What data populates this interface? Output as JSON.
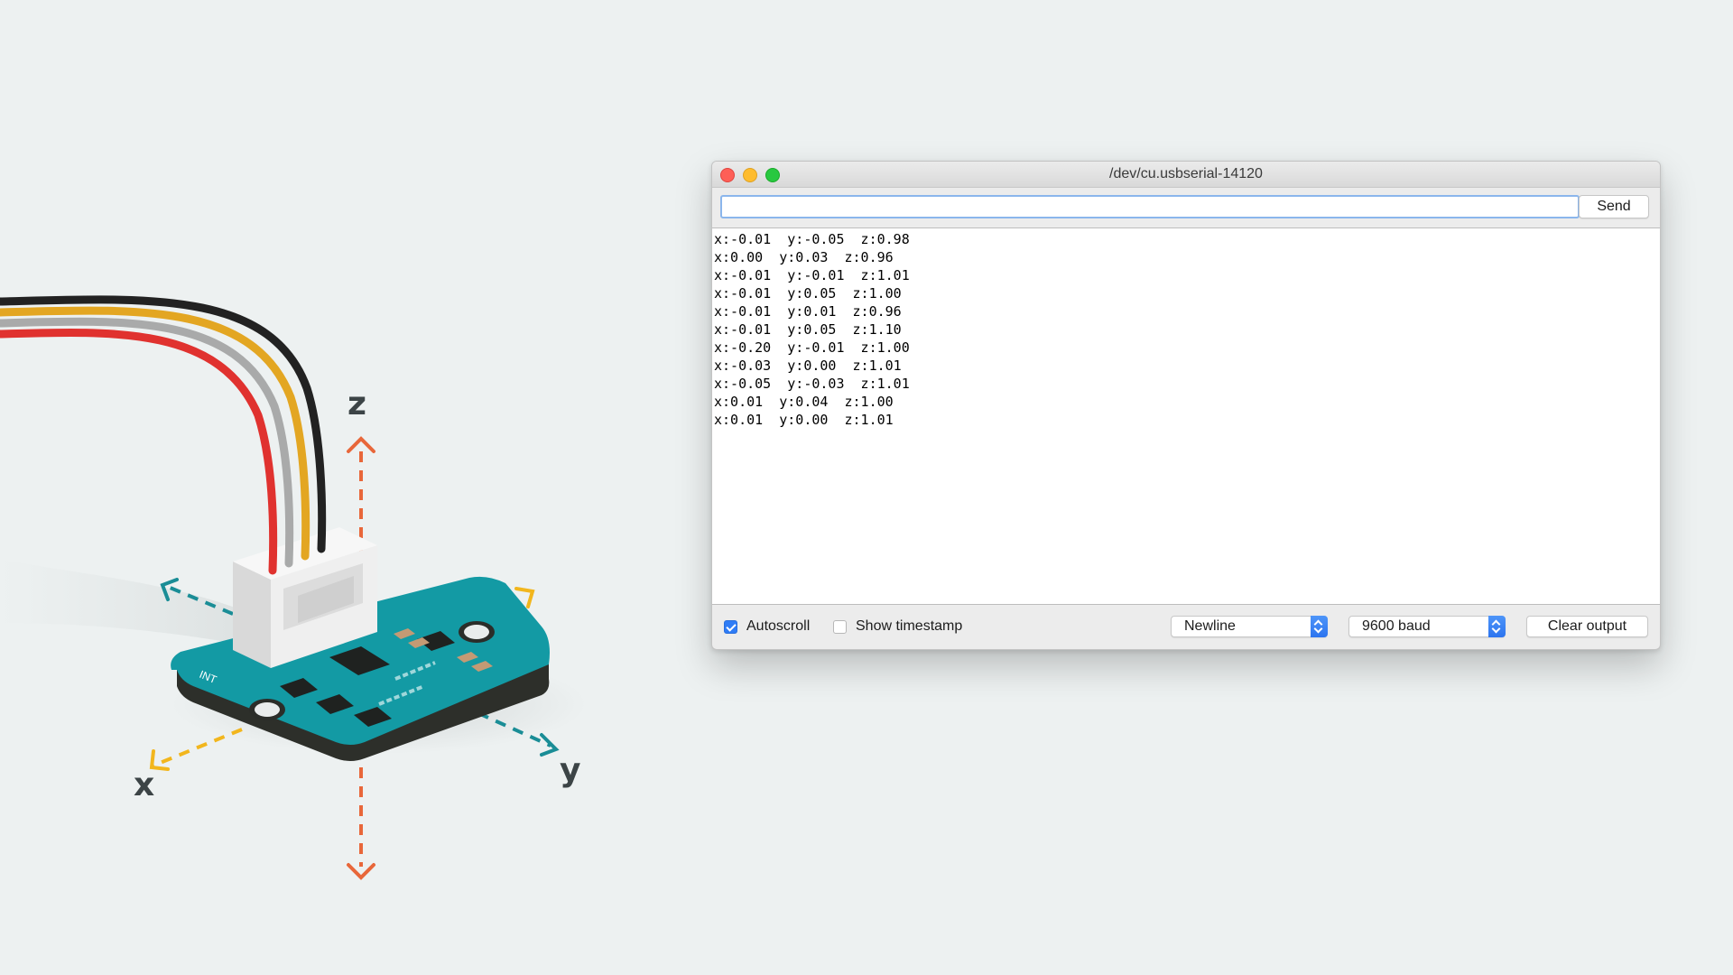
{
  "illustration": {
    "axis_labels": {
      "z": "z",
      "x": "x",
      "y": "y"
    },
    "board_text": "INT",
    "wire_colors": [
      "#222222",
      "#e3a622",
      "#a9aaaa",
      "#e0322f"
    ],
    "accent_colors": {
      "board": "#139aa4",
      "z_axis": "#e8673a",
      "x_axis": "#f2b61d",
      "y_axis": "#1a8d96"
    }
  },
  "window": {
    "title": "/dev/cu.usbserial-14120",
    "input": {
      "value": "",
      "placeholder": ""
    },
    "send_label": "Send",
    "output_lines": [
      "x:-0.01  y:-0.05  z:0.98",
      "x:0.00  y:0.03  z:0.96",
      "x:-0.01  y:-0.01  z:1.01",
      "x:-0.01  y:0.05  z:1.00",
      "x:-0.01  y:0.01  z:0.96",
      "x:-0.01  y:0.05  z:1.10",
      "x:-0.20  y:-0.01  z:1.00",
      "x:-0.03  y:0.00  z:1.01",
      "x:-0.05  y:-0.03  z:1.01",
      "x:0.01  y:0.04  z:1.00",
      "x:0.01  y:0.00  z:1.01"
    ],
    "autoscroll": {
      "label": "Autoscroll",
      "checked": true
    },
    "timestamp": {
      "label": "Show timestamp",
      "checked": false
    },
    "line_ending": "Newline",
    "baud_rate": "9600 baud",
    "clear_label": "Clear output",
    "accent_color": "#2f7cf6"
  }
}
